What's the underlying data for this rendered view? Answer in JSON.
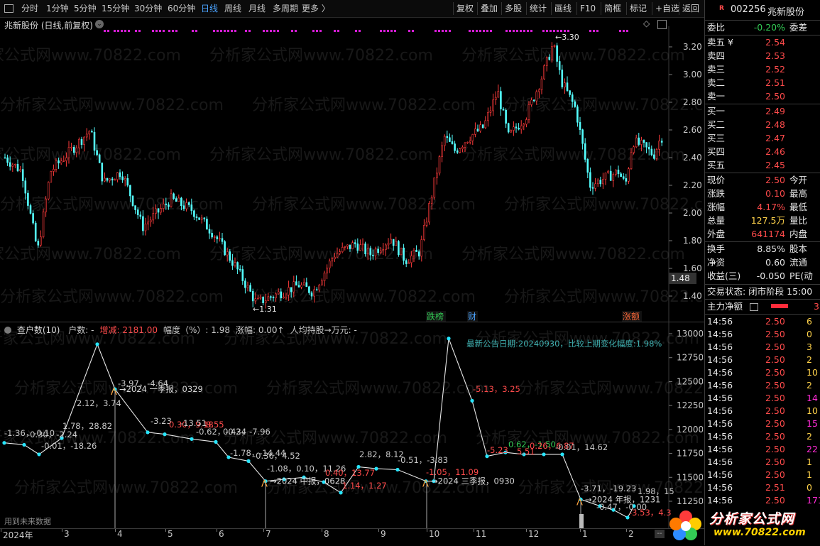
{
  "toolbar": {
    "periods": [
      "分时",
      "1分钟",
      "5分钟",
      "15分钟",
      "30分钟",
      "60分钟",
      "日线",
      "周线",
      "月线",
      "多周期",
      "更多 〉"
    ],
    "active_period": "日线",
    "right_buttons": [
      "复权",
      "叠加",
      "多股",
      "统计",
      "画线",
      "F10",
      "简框",
      "标记",
      "+自选",
      "返回"
    ]
  },
  "chart": {
    "title": "兆新股份 (日线,前复权)",
    "high_label": "3.30",
    "low_label": "1.31",
    "y_ticks": [
      "3.20",
      "3.00",
      "2.80",
      "2.60",
      "2.40",
      "2.20",
      "2.00",
      "1.80",
      "1.60",
      "1.40"
    ],
    "current_price_tag": "1.48",
    "markers": [
      {
        "label": "跌榜",
        "color": "#33cc55"
      },
      {
        "label": "财",
        "color": "#4aa3ff"
      },
      {
        "label": "涨额",
        "color": "#ff6a3a"
      }
    ],
    "watermark": "分析家公式网www.70822.com"
  },
  "indicator": {
    "name": "查户数(10)",
    "fields": [
      {
        "label": "户数: -",
        "color": "#c8c8c8"
      },
      {
        "label": "增减: 2181.00",
        "color": "#ff4b4b"
      },
      {
        "label": "幅度（%）: 1.98",
        "color": "#c8c8c8"
      },
      {
        "label": "涨幅: 0.00↑",
        "color": "#c8c8c8"
      },
      {
        "label": "人均持股→万元: -",
        "color": "#c8c8c8"
      }
    ],
    "notice": "最新公告日期:20240930，比较上期变化幅度:1.98%",
    "y_ticks": [
      "13000",
      "12750",
      "12500",
      "12250",
      "12000",
      "11750",
      "11500",
      "11250"
    ],
    "future_label": "用到未来数据",
    "reports": [
      "→2024 一季报，0329",
      "→2024 中报，0628",
      "→2024 三季报，0930",
      "→2024 年报，1231"
    ],
    "point_labels": [
      {
        "text": "-1.36，-0.10",
        "color": "#c8c8c8"
      },
      {
        "text": "-0.30，-2.24",
        "color": "#c8c8c8"
      },
      {
        "text": "-0.01，-18.26",
        "color": "#c8c8c8"
      },
      {
        "text": "1.78，28.82",
        "color": "#c8c8c8"
      },
      {
        "text": "2.12，3.74",
        "color": "#c8c8c8"
      },
      {
        "text": "-3.97，-4.64",
        "color": "#c8c8c8"
      },
      {
        "text": "-3.23",
        "color": "#c8c8c8"
      },
      {
        "text": "0.30，9.18",
        "color": "#ff4b4b"
      },
      {
        "text": "-13.51",
        "color": "#c8c8c8"
      },
      {
        "text": "8.55",
        "color": "#ff4b4b"
      },
      {
        "text": "-0.62，-0.34",
        "color": "#c8c8c8"
      },
      {
        "text": "0.42，-7.96",
        "color": "#c8c8c8"
      },
      {
        "text": "-1.78，-14.44",
        "color": "#c8c8c8"
      },
      {
        "text": "-0.36，4.52",
        "color": "#c8c8c8"
      },
      {
        "text": "-1.08，0.10，11.26",
        "color": "#c8c8c8"
      },
      {
        "text": "0.40，13.77",
        "color": "#ff4b4b"
      },
      {
        "text": "1.14，1.27",
        "color": "#ff4b4b"
      },
      {
        "text": "2.82，8.12",
        "color": "#c8c8c8"
      },
      {
        "text": "-0.51，-3.83",
        "color": "#c8c8c8"
      },
      {
        "text": "-1.05，11.09",
        "color": "#ff4b4b"
      },
      {
        "text": "-5.13，3.25",
        "color": "#ff4b4b"
      },
      {
        "text": "-5.23",
        "color": "#ff4b4b"
      },
      {
        "text": "0.62，-1.50",
        "color": "#33cc55"
      },
      {
        "text": "5.51",
        "color": "#ff4b4b"
      },
      {
        "text": "0.26，6.87",
        "color": "#ff4b4b"
      },
      {
        "text": "-0.01，14.62",
        "color": "#c8c8c8"
      },
      {
        "text": "-3.71，-19.23",
        "color": "#c8c8c8"
      },
      {
        "text": "1.98，15",
        "color": "#c8c8c8"
      },
      {
        "text": "-0.47，-0.00",
        "color": "#c8c8c8"
      },
      {
        "text": "-3.53，4.3",
        "color": "#ff4b4b"
      }
    ],
    "x_labels": [
      "2024年",
      "3",
      "4",
      "5",
      "6",
      "7",
      "8",
      "9",
      "10",
      "11",
      "12",
      "1",
      "2"
    ]
  },
  "quote": {
    "code": "002256",
    "name": "兆新股份",
    "weibi_label": "委比",
    "weibi_value": "-0.20%",
    "weicha_label": "委差",
    "asks": [
      {
        "label": "卖五 ¥",
        "price": "2.54"
      },
      {
        "label": "卖四",
        "price": "2.53"
      },
      {
        "label": "卖三",
        "price": "2.52"
      },
      {
        "label": "卖二",
        "price": "2.51"
      },
      {
        "label": "卖一",
        "price": "2.50"
      }
    ],
    "bids": [
      {
        "label": "买一",
        "price": "2.49"
      },
      {
        "label": "买二",
        "price": "2.48"
      },
      {
        "label": "买三",
        "price": "2.47"
      },
      {
        "label": "买四",
        "price": "2.46"
      },
      {
        "label": "买五",
        "price": "2.45"
      }
    ],
    "stats": [
      {
        "label": "现价",
        "value": "2.50",
        "color": "#ff4b4b",
        "label2": "今开"
      },
      {
        "label": "涨跌",
        "value": "0.10",
        "color": "#ff4b4b",
        "label2": "最高"
      },
      {
        "label": "涨幅",
        "value": "4.17%",
        "color": "#ff4b4b",
        "label2": "最低"
      },
      {
        "label": "总量",
        "value": "127.5万",
        "color": "#ffd24a",
        "label2": "量比"
      },
      {
        "label": "外盘",
        "value": "641174",
        "color": "#ff4b4b",
        "label2": "内盘"
      }
    ],
    "stats2": [
      {
        "label": "换手",
        "value": "8.85%",
        "label2": "股本"
      },
      {
        "label": "净资",
        "value": "0.60",
        "label2": "流通"
      },
      {
        "label": "收益(三)",
        "value": "-0.050",
        "label2": "PE(动"
      }
    ],
    "trade_state": "交易状态: 闭市阶段 15:00",
    "main_net_label": "主力净额",
    "main_net_value": "3",
    "ticks": [
      {
        "time": "14:56",
        "price": "2.50",
        "vol": "6",
        "color": "#ffd24a"
      },
      {
        "time": "14:56",
        "price": "2.50",
        "vol": "0",
        "color": "#ffd24a"
      },
      {
        "time": "14:56",
        "price": "2.50",
        "vol": "3",
        "color": "#ffd24a"
      },
      {
        "time": "14:56",
        "price": "2.50",
        "vol": "2",
        "color": "#ffd24a"
      },
      {
        "time": "14:56",
        "price": "2.50",
        "vol": "10",
        "color": "#ffd24a"
      },
      {
        "time": "14:56",
        "price": "2.50",
        "vol": "2",
        "color": "#ffd24a"
      },
      {
        "time": "14:56",
        "price": "2.50",
        "vol": "14",
        "color": "#ff2bd6"
      },
      {
        "time": "14:56",
        "price": "2.50",
        "vol": "10",
        "color": "#ffd24a"
      },
      {
        "time": "14:56",
        "price": "2.50",
        "vol": "15",
        "color": "#ff2bd6"
      },
      {
        "time": "14:56",
        "price": "2.50",
        "vol": "2",
        "color": "#ffd24a"
      },
      {
        "time": "14:56",
        "price": "2.50",
        "vol": "22",
        "color": "#ff2bd6"
      },
      {
        "time": "14:56",
        "price": "2.50",
        "vol": "1",
        "color": "#ffd24a"
      },
      {
        "time": "14:56",
        "price": "2.50",
        "vol": "1",
        "color": "#ffd24a"
      },
      {
        "time": "14:56",
        "price": "2.51",
        "vol": "0",
        "color": "#ffd24a"
      },
      {
        "time": "14:56",
        "price": "2.50",
        "vol": "171",
        "color": "#ff2bd6"
      }
    ],
    "logo_text": "分析家公式网",
    "logo_url": "www.70822.com"
  }
}
